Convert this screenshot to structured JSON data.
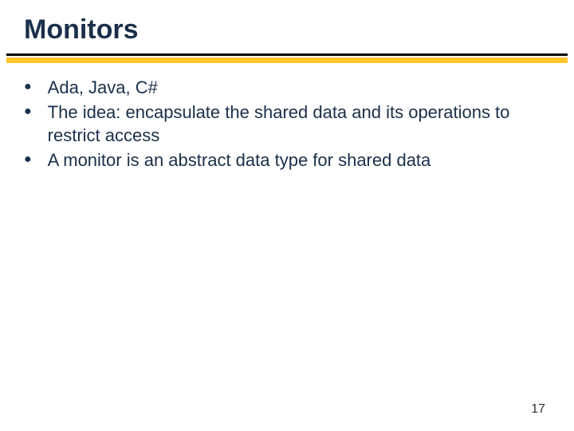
{
  "slide": {
    "title": "Monitors",
    "bullets": [
      "Ada, Java, C#",
      "The idea: encapsulate the shared data and its operations to restrict access",
      "A monitor is an abstract data type for shared data"
    ],
    "page_number": "17"
  }
}
